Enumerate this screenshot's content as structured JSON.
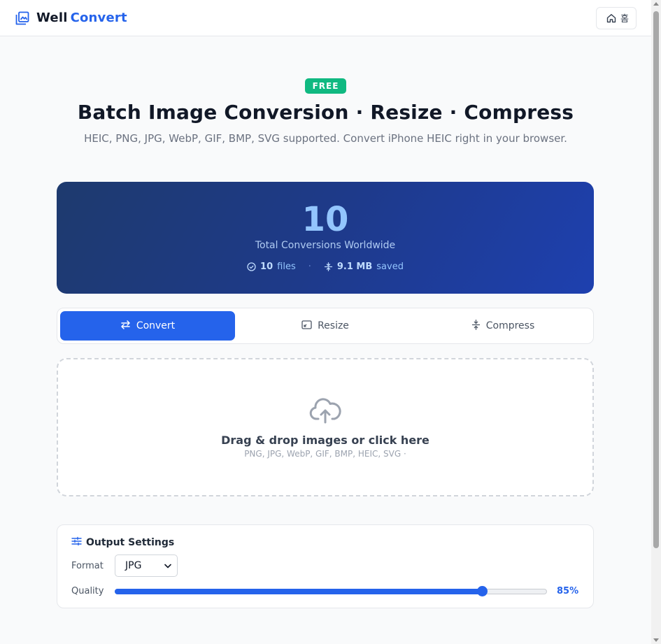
{
  "header": {
    "brand_word1": "Well",
    "brand_word2": "Convert",
    "home_label": "홈"
  },
  "hero": {
    "badge": "FREE",
    "title": "Batch Image Conversion · Resize · Compress",
    "subtitle": "HEIC, PNG, JPG, WebP, GIF, BMP, SVG supported. Convert iPhone HEIC right in your browser."
  },
  "stats": {
    "total": "10",
    "total_label": "Total Conversions Worldwide",
    "files_count": "10",
    "files_label": "files",
    "saved_amount": "9.1 MB",
    "saved_label": "saved",
    "separator": "·"
  },
  "tabs": [
    {
      "label": "Convert",
      "icon": "arrows-exchange-icon",
      "active": true
    },
    {
      "label": "Resize",
      "icon": "resize-icon",
      "active": false
    },
    {
      "label": "Compress",
      "icon": "compress-icon",
      "active": false
    }
  ],
  "dropzone": {
    "icon": "cloud-upload-icon",
    "title": "Drag & drop images or click here",
    "subtitle": "PNG, JPG, WebP, GIF, BMP, HEIC, SVG ·"
  },
  "settings": {
    "title": "Output Settings",
    "format_label": "Format",
    "format_value": "JPG",
    "quality_label": "Quality",
    "quality_value": 85,
    "quality_text": "85%"
  },
  "colors": {
    "accent": "#2563eb",
    "badge": "#10b981",
    "stats_bg": "#1e3a8a"
  }
}
